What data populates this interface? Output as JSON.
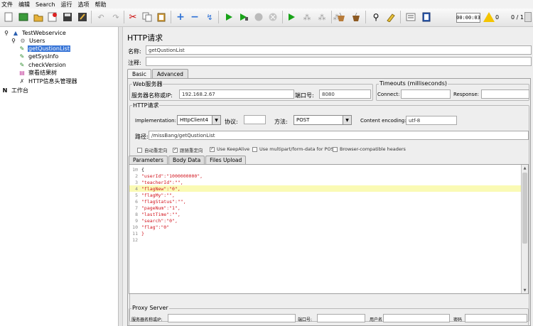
{
  "menu": [
    "文件",
    "编辑",
    "Search",
    "运行",
    "选项",
    "帮助"
  ],
  "toolbar": {
    "timer": "00:00:03",
    "warning_count": "0",
    "threads": "0 / 1"
  },
  "tree": {
    "items": [
      {
        "label": "TestWebservice"
      },
      {
        "label": "Users"
      },
      {
        "label": "getQustionList"
      },
      {
        "label": "getSysInfo"
      },
      {
        "label": "checkVersion"
      },
      {
        "label": "察看结果树"
      },
      {
        "label": "HTTP信息头管理器"
      },
      {
        "label": "工作台"
      }
    ]
  },
  "panel": {
    "title": "HTTP请求",
    "name_label": "名称:",
    "name_value": "getQustionList",
    "comment_label": "注释:",
    "comment_value": "",
    "tabs": [
      "Basic",
      "Advanced"
    ],
    "web_server": {
      "title": "Web服务器",
      "server_label": "服务器名称或IP:",
      "server_value": "192.168.2.67",
      "port_label": "端口号:",
      "port_value": "8080"
    },
    "timeouts": {
      "title": "Timeouts (milliseconds)",
      "connect_label": "Connect:",
      "connect_value": "",
      "response_label": "Response:",
      "response_value": ""
    },
    "http_request": {
      "title": "HTTP请求",
      "impl_label": "Implementation:",
      "impl_value": "HttpClient4",
      "protocol_label": "协议:",
      "protocol_value": "",
      "method_label": "方法:",
      "method_value": "POST",
      "encoding_label": "Content encoding:",
      "encoding_value": "utf-8",
      "path_label": "路径:",
      "path_value": "/missBang/getQustionList"
    },
    "checkboxes": [
      {
        "label": "自动重定向",
        "checked": false
      },
      {
        "label": "跟随重定向",
        "checked": true
      },
      {
        "label": "Use KeepAlive",
        "checked": true
      },
      {
        "label": "Use multipart/form-data for POST",
        "checked": false
      },
      {
        "label": "Browser-compatible headers",
        "checked": false
      }
    ],
    "subtabs": [
      "Parameters",
      "Body Data",
      "Files Upload"
    ],
    "body_lines": [
      "{",
      "\"userId\":\"1000000000\",",
      "\"teacherId\":\"\",",
      "\"flagNew\":\"0\",",
      "\"flagMy\":\"\",",
      "\"flagStatus\":\"\",",
      "\"pageNum\":\"1\",",
      "\"lastTime\":\"\",",
      "\"search\":\"0\",",
      "\"flag\":\"0\"",
      "}",
      ""
    ],
    "highlight_line": 4,
    "proxy": {
      "title": "Proxy Server",
      "server_label": "服务器名称或IP:",
      "port_label": "端口号:",
      "user_label": "用户名",
      "password_label": "密码"
    }
  }
}
